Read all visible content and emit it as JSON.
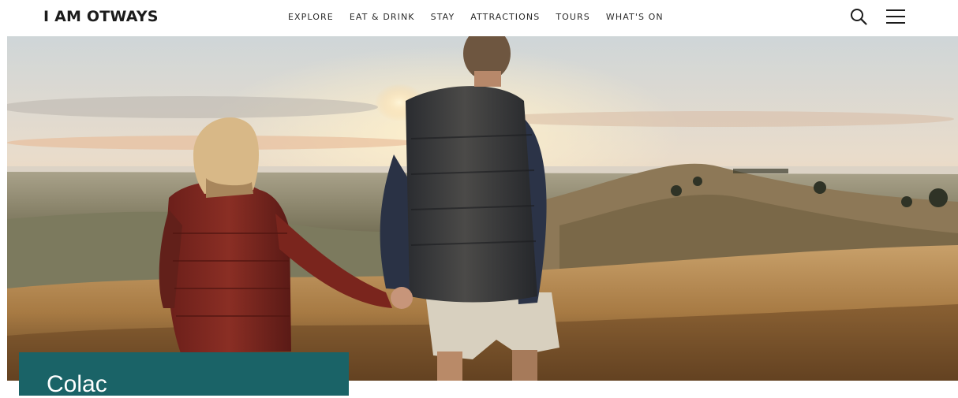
{
  "header": {
    "logo": "I AM OTWAYS",
    "nav": [
      "EXPLORE",
      "EAT & DRINK",
      "STAY",
      "ATTRACTIONS",
      "TOURS",
      "WHAT'S ON"
    ],
    "icons": {
      "search": "search-icon",
      "menu": "hamburger-menu-icon"
    }
  },
  "hero": {
    "image": "couple-holding-hands-on-grassy-hill-at-sunset-photo"
  },
  "title_card": {
    "title": "Colac",
    "background": "#1a6367"
  }
}
